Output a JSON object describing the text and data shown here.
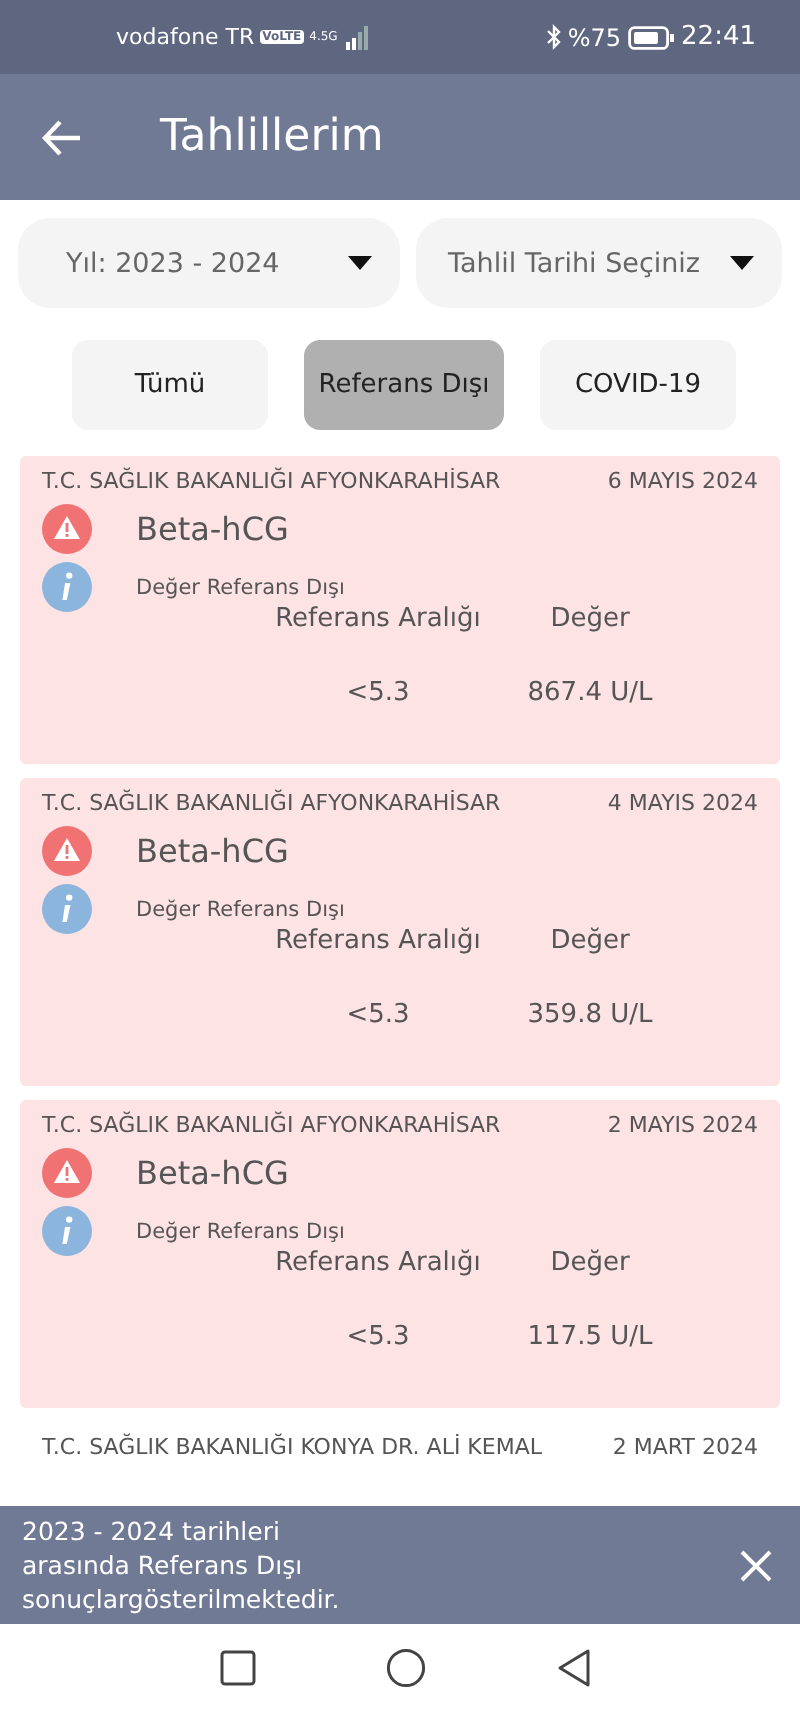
{
  "status_bar": {
    "carrier": "vodafone TR",
    "volte": "VoLTE",
    "network": "4.5G",
    "battery": "%75",
    "time": "22:41"
  },
  "header": {
    "title": "Tahlillerim"
  },
  "filters": [
    {
      "value": "Yıl: 2023 - 2024"
    },
    {
      "value": "Tahlil Tarihi Seçiniz"
    }
  ],
  "chips": [
    {
      "label": "Tümü",
      "selected": false
    },
    {
      "label": "Referans Dışı",
      "selected": true
    },
    {
      "label": "COVID-19",
      "selected": false
    }
  ],
  "results": [
    {
      "institution": "T.C. SAĞLIK BAKANLIĞI AFYONKARAHİSAR",
      "date": "6 MAYIS 2024",
      "test": "Beta-hCG",
      "status": "Değer Referans Dışı",
      "range_label": "Referans Aralığı",
      "value_label": "Değer",
      "range": "<5.3",
      "value": "867.4 U/L",
      "out_of_range": true
    },
    {
      "institution": "T.C. SAĞLIK BAKANLIĞI AFYONKARAHİSAR",
      "date": "4 MAYIS 2024",
      "test": "Beta-hCG",
      "status": "Değer Referans Dışı",
      "range_label": "Referans Aralığı",
      "value_label": "Değer",
      "range": "<5.3",
      "value": "359.8 U/L",
      "out_of_range": true
    },
    {
      "institution": "T.C. SAĞLIK BAKANLIĞI AFYONKARAHİSAR",
      "date": "2 MAYIS 2024",
      "test": "Beta-hCG",
      "status": "Değer Referans Dışı",
      "range_label": "Referans Aralığı",
      "value_label": "Değer",
      "range": "<5.3",
      "value": "117.5 U/L",
      "out_of_range": true
    },
    {
      "institution": "T.C. SAĞLIK BAKANLIĞI KONYA DR. ALİ KEMAL",
      "date": "2 MART 2024"
    }
  ],
  "snackbar": {
    "message": "2023 - 2024 tarihleri arasında Referans Dışı sonuçlargösterilmektedir."
  }
}
